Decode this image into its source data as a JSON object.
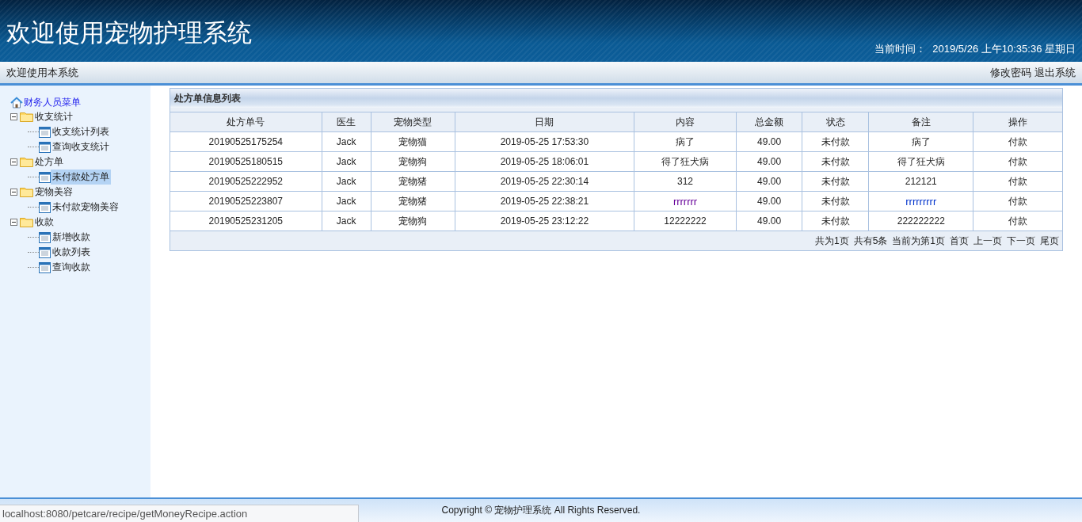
{
  "header": {
    "title": "欢迎使用宠物护理系统",
    "time_label": "当前时间：",
    "time_value": "2019/5/26 上午10:35:36 星期日"
  },
  "navbar": {
    "welcome": "欢迎使用本系统",
    "links": [
      "修改密码",
      "退出系统"
    ]
  },
  "sidebar": {
    "root": "财务人员菜单",
    "items": [
      {
        "label": "收支统计",
        "expanded": true,
        "children": [
          {
            "label": "收支统计列表",
            "selected": false
          },
          {
            "label": "查询收支统计",
            "selected": false
          }
        ]
      },
      {
        "label": "处方单",
        "expanded": true,
        "children": [
          {
            "label": "未付款处方单",
            "selected": true
          }
        ]
      },
      {
        "label": "宠物美容",
        "expanded": true,
        "children": [
          {
            "label": "未付款宠物美容",
            "selected": false
          }
        ]
      },
      {
        "label": "收款",
        "expanded": true,
        "children": [
          {
            "label": "新增收款",
            "selected": false
          },
          {
            "label": "收款列表",
            "selected": false
          },
          {
            "label": "查询收款",
            "selected": false
          }
        ]
      }
    ]
  },
  "panel": {
    "title": "处方单信息列表",
    "table": {
      "columns": [
        "处方单号",
        "医生",
        "宠物类型",
        "日期",
        "内容",
        "总金额",
        "状态",
        "备注",
        "操作"
      ],
      "rows": [
        [
          "20190525175254",
          "Jack",
          "宠物猫",
          "2019-05-25 17:53:30",
          "病了",
          "49.00",
          "未付款",
          "病了",
          "付款"
        ],
        [
          "20190525180515",
          "Jack",
          "宠物狗",
          "2019-05-25 18:06:01",
          "得了狂犬病",
          "49.00",
          "未付款",
          "得了狂犬病",
          "付款"
        ],
        [
          "20190525222952",
          "Jack",
          "宠物猪",
          "2019-05-25 22:30:14",
          "312",
          "49.00",
          "未付款",
          "212121",
          "付款"
        ],
        [
          "20190525223807",
          "Jack",
          "宠物猪",
          "2019-05-25 22:38:21",
          {
            "text": "rrrrrrr",
            "color": "#660099"
          },
          "49.00",
          "未付款",
          {
            "text": "rrrrrrrrr",
            "color": "#0033cc"
          },
          "付款"
        ],
        [
          "20190525231205",
          "Jack",
          "宠物狗",
          "2019-05-25 23:12:22",
          "12222222",
          "49.00",
          "未付款",
          "222222222",
          "付款"
        ]
      ]
    },
    "pager": {
      "info": [
        "共为1页",
        "共有5条",
        "当前为第1页"
      ],
      "links": [
        "首页",
        "上一页",
        "下一页",
        "尾页"
      ]
    }
  },
  "footer": {
    "copyright": "Copyright © 宠物护理系统 All Rights Reserved."
  },
  "status_url": "localhost:8080/petcare/recipe/getMoneyRecipe.action"
}
